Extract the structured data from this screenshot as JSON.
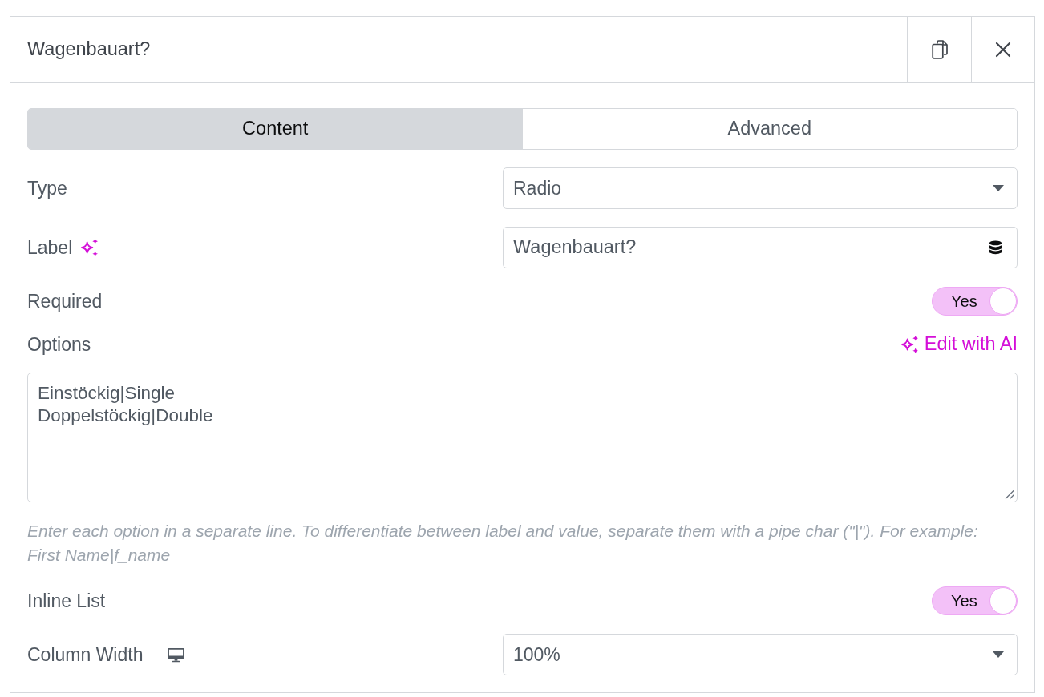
{
  "panel": {
    "title": "Wagenbauart?"
  },
  "tabs": [
    {
      "label": "Content",
      "selected": true
    },
    {
      "label": "Advanced",
      "selected": false
    }
  ],
  "fields": [
    {
      "kind": "select",
      "label": "Type",
      "value": "Radio"
    },
    {
      "kind": "text",
      "label": "Label",
      "ai": true,
      "value": "Wagenbauart?"
    },
    {
      "kind": "switch",
      "label": "Required",
      "on": true,
      "switch_text": "Yes"
    },
    {
      "kind": "textarea",
      "label": "Options",
      "action": "Edit with AI",
      "lines": [
        "Einstöckig|Single",
        "Doppelstöckig|Double"
      ],
      "help": "Enter each option in a separate line. To differentiate between label and value, separate them with a pipe char (\"|\"). For example: First Name|f_name"
    },
    {
      "kind": "switch",
      "label": "Inline List",
      "on": true,
      "switch_text": "Yes"
    },
    {
      "kind": "select",
      "label": "Column Width",
      "responsive": true,
      "value": "100%"
    }
  ]
}
